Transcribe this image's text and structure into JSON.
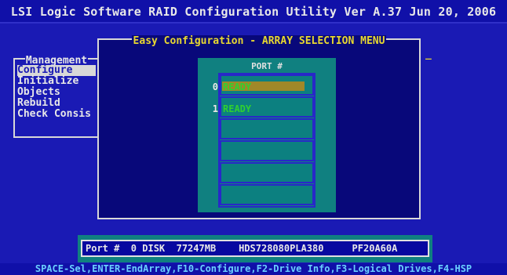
{
  "window": {
    "title": "LSI Logic Software RAID Configuration Utility Ver A.37 Jun 20, 2006"
  },
  "management_menu": {
    "title": "Management",
    "items": [
      {
        "label": "Configure",
        "selected": true
      },
      {
        "label": "Initialize",
        "selected": false
      },
      {
        "label": "Objects",
        "selected": false
      },
      {
        "label": "Rebuild",
        "selected": false
      },
      {
        "label": "Check Consis",
        "selected": false
      }
    ]
  },
  "dialog": {
    "title": "Easy Configuration - ARRAY SELECTION MENU",
    "cursor_mark": "_",
    "port_header": "PORT #",
    "drives": [
      {
        "port": "0",
        "status": "READY",
        "selected": true
      },
      {
        "port": "1",
        "status": "READY",
        "selected": false
      },
      {
        "port": "",
        "status": ""
      },
      {
        "port": "",
        "status": ""
      },
      {
        "port": "",
        "status": ""
      },
      {
        "port": "",
        "status": ""
      }
    ]
  },
  "drive_info": {
    "text": "Port #  0 DISK  77247MB    HDS728080PLA380     PF20A60A"
  },
  "status_bar": {
    "text": "SPACE-Sel,ENTER-EndArray,F10-Configure,F2-Drive Info,F3-Logical Drives,F4-HSP"
  },
  "colors": {
    "background": "#1a1ab4",
    "dialog_bg": "#08087a",
    "panel_teal": "#108080",
    "ready_green": "#30d030",
    "title_yellow": "#e8d830"
  }
}
